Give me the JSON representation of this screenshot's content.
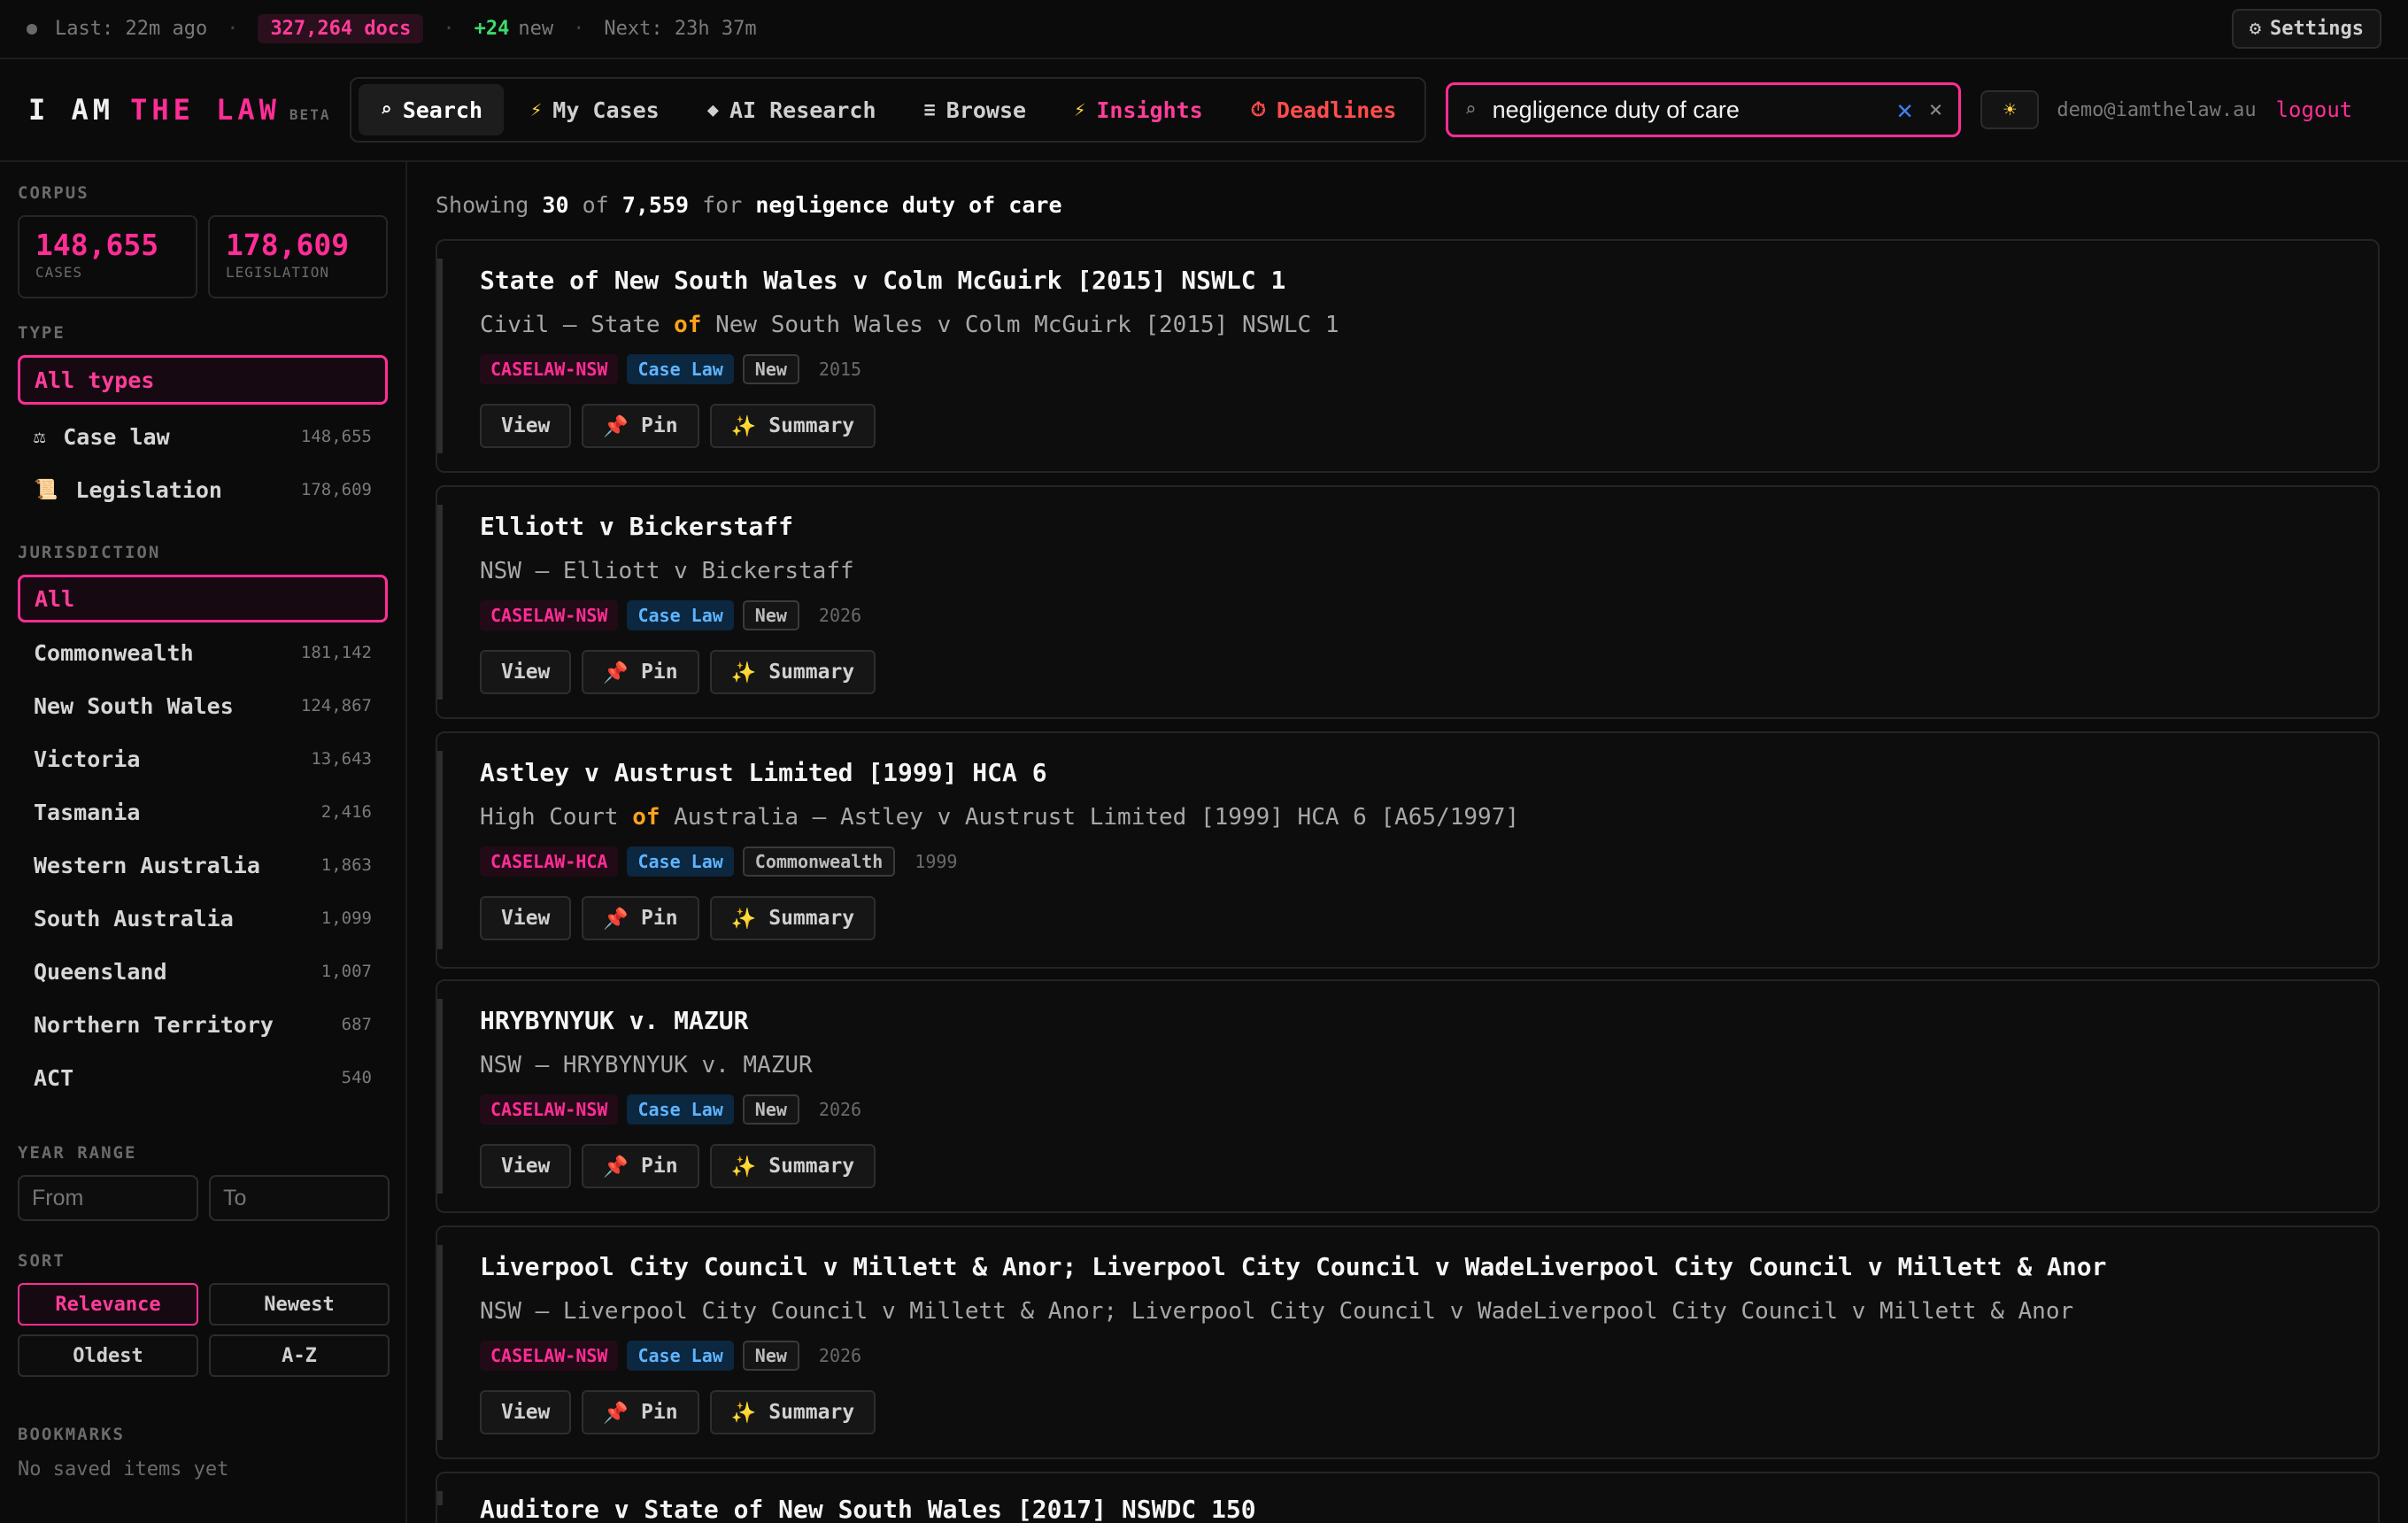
{
  "status": {
    "last": "Last: 22m ago",
    "docs": "327,264 docs",
    "new_count": "+24",
    "new_label": "new",
    "next": "Next: 23h 37m",
    "settings_label": "Settings"
  },
  "header": {
    "logo_main": "I AM",
    "logo_accent": "THE LAW",
    "logo_badge": "BETA",
    "nav": [
      {
        "label": "Search",
        "icon": "⌕"
      },
      {
        "label": "My Cases",
        "icon": "⚡"
      },
      {
        "label": "AI Research",
        "icon": "◆"
      },
      {
        "label": "Browse",
        "icon": "≡"
      },
      {
        "label": "Insights",
        "icon": "⚡"
      },
      {
        "label": "Deadlines",
        "icon": "⏱"
      }
    ],
    "search_value": "negligence duty of care",
    "user_email": "demo@iamthelaw.au",
    "logout_label": "logout"
  },
  "sidebar": {
    "corpus_label": "CORPUS",
    "corpus": [
      {
        "num": "148,655",
        "label": "CASES"
      },
      {
        "num": "178,609",
        "label": "LEGISLATION"
      }
    ],
    "type_label": "TYPE",
    "type_active": "All types",
    "types": [
      {
        "label": "Case law",
        "icon": "⚖",
        "count": "148,655"
      },
      {
        "label": "Legislation",
        "icon": "📜",
        "count": "178,609"
      }
    ],
    "jurisdiction_label": "JURISDICTION",
    "jurisdiction_active": "All",
    "jurisdictions": [
      {
        "label": "Commonwealth",
        "count": "181,142"
      },
      {
        "label": "New South Wales",
        "count": "124,867"
      },
      {
        "label": "Victoria",
        "count": "13,643"
      },
      {
        "label": "Tasmania",
        "count": "2,416"
      },
      {
        "label": "Western Australia",
        "count": "1,863"
      },
      {
        "label": "South Australia",
        "count": "1,099"
      },
      {
        "label": "Queensland",
        "count": "1,007"
      },
      {
        "label": "Northern Territory",
        "count": "687"
      },
      {
        "label": "ACT",
        "count": "540"
      }
    ],
    "year_label": "YEAR RANGE",
    "year_from_placeholder": "From",
    "year_to_placeholder": "To",
    "sort_label": "SORT",
    "sort": [
      "Relevance",
      "Newest",
      "Oldest",
      "A-Z"
    ],
    "bookmarks_label": "BOOKMARKS",
    "bookmarks_empty": "No saved items yet"
  },
  "main": {
    "showing_prefix": "Showing",
    "showing_count": "30",
    "showing_of": "of",
    "showing_total": "7,559",
    "showing_for": "for",
    "showing_query": "negligence duty of care",
    "actions": {
      "view": "View",
      "pin": "Pin",
      "summary": "Summary"
    },
    "results": [
      {
        "title": "State of New South Wales v Colm McGuirk [2015] NSWLC 1",
        "sub_pre": "Civil — State ",
        "sub_hl": "of",
        "sub_post": " New South Wales v Colm McGuirk [2015] NSWLC 1",
        "source": "CASELAW-NSW",
        "type": "Case Law",
        "tag": "New",
        "year": "2015"
      },
      {
        "title": "Elliott v Bickerstaff",
        "sub_pre": "NSW — Elliott v Bickerstaff",
        "sub_hl": "",
        "sub_post": "",
        "source": "CASELAW-NSW",
        "type": "Case Law",
        "tag": "New",
        "year": "2026"
      },
      {
        "title": "Astley v Austrust Limited [1999] HCA 6",
        "sub_pre": "High Court ",
        "sub_hl": "of",
        "sub_post": " Australia — Astley v Austrust Limited [1999] HCA 6 [A65/1997]",
        "source": "CASELAW-HCA",
        "type": "Case Law",
        "tag": "Commonwealth",
        "year": "1999"
      },
      {
        "title": "HRYBYNYUK v. MAZUR",
        "sub_pre": "NSW — HRYBYNYUK v. MAZUR",
        "sub_hl": "",
        "sub_post": "",
        "source": "CASELAW-NSW",
        "type": "Case Law",
        "tag": "New",
        "year": "2026"
      },
      {
        "title": "Liverpool City Council v Millett & Anor; Liverpool City Council v WadeLiverpool City Council v Millett & Anor",
        "sub_pre": "NSW — Liverpool City Council v Millett & Anor; Liverpool City Council v WadeLiverpool City Council v Millett & Anor",
        "sub_hl": "",
        "sub_post": "",
        "source": "CASELAW-NSW",
        "type": "Case Law",
        "tag": "New",
        "year": "2026"
      },
      {
        "title": "Auditore v State of New South Wales [2017] NSWDC 150",
        "sub_pre": "",
        "sub_hl": "",
        "sub_post": "",
        "source": "",
        "type": "",
        "tag": "",
        "year": ""
      }
    ]
  }
}
